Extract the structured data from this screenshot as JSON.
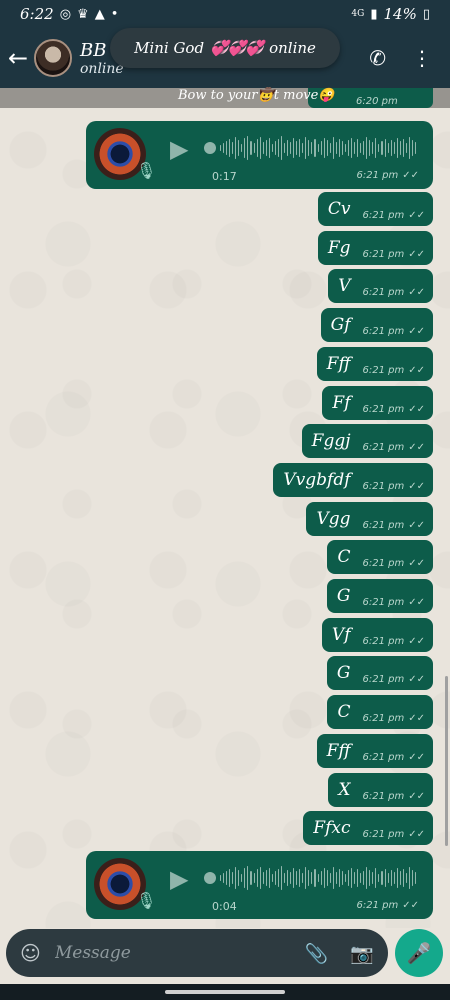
{
  "status_bar": {
    "time": "6:22",
    "network": "4G",
    "battery": "14%",
    "icons": [
      "whatsapp-icon",
      "crown-icon",
      "warning-icon",
      "dot-icon",
      "signal-icon",
      "battery-icon"
    ]
  },
  "header": {
    "contact_name": "BB",
    "contact_status": "online",
    "actions": [
      "video-call-icon",
      "phone-icon",
      "more-vert-icon"
    ]
  },
  "toast": {
    "prefix": "Mini God",
    "hearts": "💞💞💞",
    "suffix": "online"
  },
  "pinned": {
    "text": "Bow to your🤠t move😜",
    "time": "6:20 pm"
  },
  "voice_notes": [
    {
      "duration": "0:17",
      "time": "6:21 pm"
    },
    {
      "duration": "0:04",
      "time": "6:21 pm"
    }
  ],
  "messages": [
    {
      "text": "Cv",
      "time": "6:21 pm"
    },
    {
      "text": "Fg",
      "time": "6:21 pm"
    },
    {
      "text": "V",
      "time": "6:21 pm"
    },
    {
      "text": "Gf",
      "time": "6:21 pm"
    },
    {
      "text": "Fff",
      "time": "6:21 pm"
    },
    {
      "text": "Ff",
      "time": "6:21 pm"
    },
    {
      "text": "Fggj",
      "time": "6:21 pm"
    },
    {
      "text": "Vvgbfdf",
      "time": "6:21 pm"
    },
    {
      "text": "Vgg",
      "time": "6:21 pm"
    },
    {
      "text": "C",
      "time": "6:21 pm"
    },
    {
      "text": "G",
      "time": "6:21 pm"
    },
    {
      "text": "Vf",
      "time": "6:21 pm"
    },
    {
      "text": "G",
      "time": "6:21 pm"
    },
    {
      "text": "C",
      "time": "6:21 pm"
    },
    {
      "text": "Fff",
      "time": "6:21 pm"
    },
    {
      "text": "X",
      "time": "6:21 pm"
    },
    {
      "text": "Ffxc",
      "time": "6:21 pm"
    }
  ],
  "composer": {
    "placeholder": "Message"
  },
  "colors": {
    "bar": "#1e3540",
    "bubble": "#0d5c4a",
    "accent": "#14a98c",
    "chat_bg": "#e9e4dc"
  }
}
